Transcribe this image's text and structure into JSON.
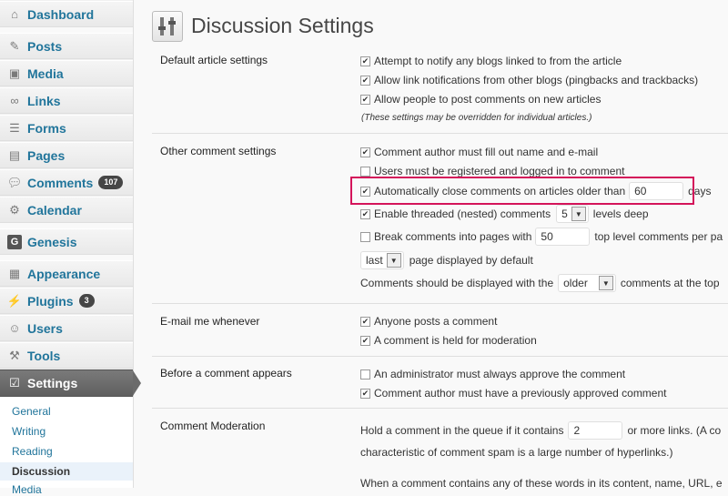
{
  "sidebar": {
    "items": [
      {
        "label": "Dashboard",
        "icon": "dashboard-icon"
      },
      {
        "label": "Posts",
        "icon": "pin-icon"
      },
      {
        "label": "Media",
        "icon": "media-icon"
      },
      {
        "label": "Links",
        "icon": "link-icon"
      },
      {
        "label": "Forms",
        "icon": "form-icon"
      },
      {
        "label": "Pages",
        "icon": "page-icon"
      },
      {
        "label": "Comments",
        "icon": "comment-icon",
        "badge": "107"
      },
      {
        "label": "Calendar",
        "icon": "gear-icon"
      },
      {
        "label": "Genesis",
        "icon": "genesis-icon"
      },
      {
        "label": "Appearance",
        "icon": "appearance-icon"
      },
      {
        "label": "Plugins",
        "icon": "plugin-icon",
        "badge": "3"
      },
      {
        "label": "Users",
        "icon": "users-icon"
      },
      {
        "label": "Tools",
        "icon": "tools-icon"
      },
      {
        "label": "Settings",
        "icon": "settings-icon"
      }
    ],
    "submenu": [
      "General",
      "Writing",
      "Reading",
      "Discussion",
      "Media"
    ]
  },
  "page": {
    "title": "Discussion Settings"
  },
  "sections": {
    "default_article": {
      "label": "Default article settings",
      "options": [
        "Attempt to notify any blogs linked to from the article",
        "Allow link notifications from other blogs (pingbacks and trackbacks)",
        "Allow people to post comments on new articles"
      ],
      "note": "(These settings may be overridden for individual articles.)"
    },
    "other_comment": {
      "label": "Other comment settings",
      "name_email": "Comment author must fill out name and e-mail",
      "registered": "Users must be registered and logged in to comment",
      "auto_close": "Automatically close comments on articles older than",
      "auto_close_value": "60",
      "auto_close_unit": "days",
      "threaded": "Enable threaded (nested) comments",
      "threaded_value": "5",
      "threaded_suffix": "levels deep",
      "break_pages": "Break comments into pages with",
      "break_pages_value": "50",
      "break_pages_suffix": "top level comments per pa",
      "page_default_value": "last",
      "page_default_suffix": "page displayed by default",
      "display_prefix": "Comments should be displayed with the",
      "display_value": "older",
      "display_suffix": "comments at the top"
    },
    "email_me": {
      "label": "E-mail me whenever",
      "options": [
        "Anyone posts a comment",
        "A comment is held for moderation"
      ]
    },
    "before_appears": {
      "label": "Before a comment appears",
      "options": [
        "An administrator must always approve the comment",
        "Comment author must have a previously approved comment"
      ]
    },
    "moderation": {
      "label": "Comment Moderation",
      "hold_prefix": "Hold a comment in the queue if it contains",
      "hold_value": "2",
      "hold_suffix": "or more links. (A co",
      "line2": "characteristic of comment spam is a large number of hyperlinks.)",
      "line3": "When a comment contains any of these words in its content, name, URL, e"
    }
  },
  "colors": {
    "link": "#21759b",
    "highlight": "#d4145a"
  }
}
